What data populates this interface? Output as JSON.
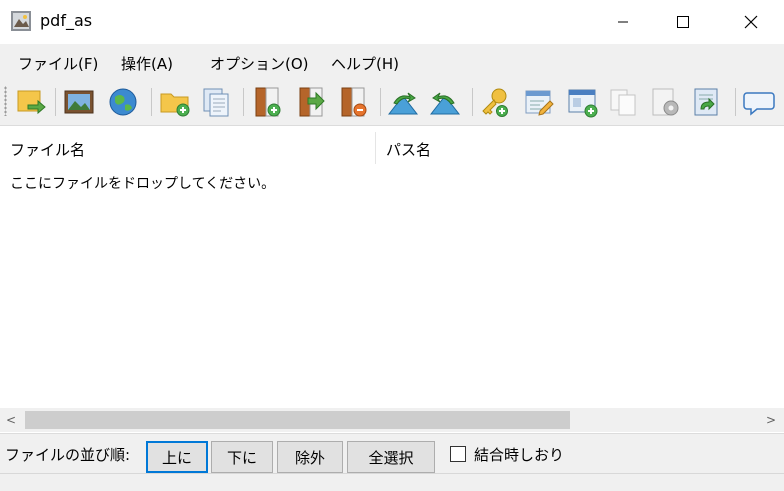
{
  "window": {
    "title": "pdf_as",
    "icon": "pdf-app-icon"
  },
  "menu": [
    "ファイル(F)",
    "操作(A)",
    "オプション(O)",
    "ヘルプ(H)"
  ],
  "toolbar": {
    "buttons": [
      "open-file-icon",
      "image-icon",
      "globe-icon",
      "add-folder-icon",
      "copy-pages-icon",
      "insert-page-icon",
      "move-page-icon",
      "remove-page-icon",
      "rotate-left-icon",
      "rotate-right-icon",
      "key-add-icon",
      "edit-document-icon",
      "window-add-icon",
      "duplicate-icon",
      "settings-page-icon",
      "refresh-page-icon",
      "comment-icon"
    ]
  },
  "list": {
    "columns": [
      "ファイル名",
      "パス名"
    ],
    "empty_hint": "ここにファイルをドロップしてください。"
  },
  "scrollbar": {
    "left_arrow": "<",
    "right_arrow": ">"
  },
  "bottom": {
    "order_label": "ファイルの並び順:",
    "up_label": "上に",
    "down_label": "下に",
    "remove_label": "除外",
    "select_all_label": "全選択",
    "bookmark_label": "結合時しおり",
    "bookmark_checked": false
  }
}
